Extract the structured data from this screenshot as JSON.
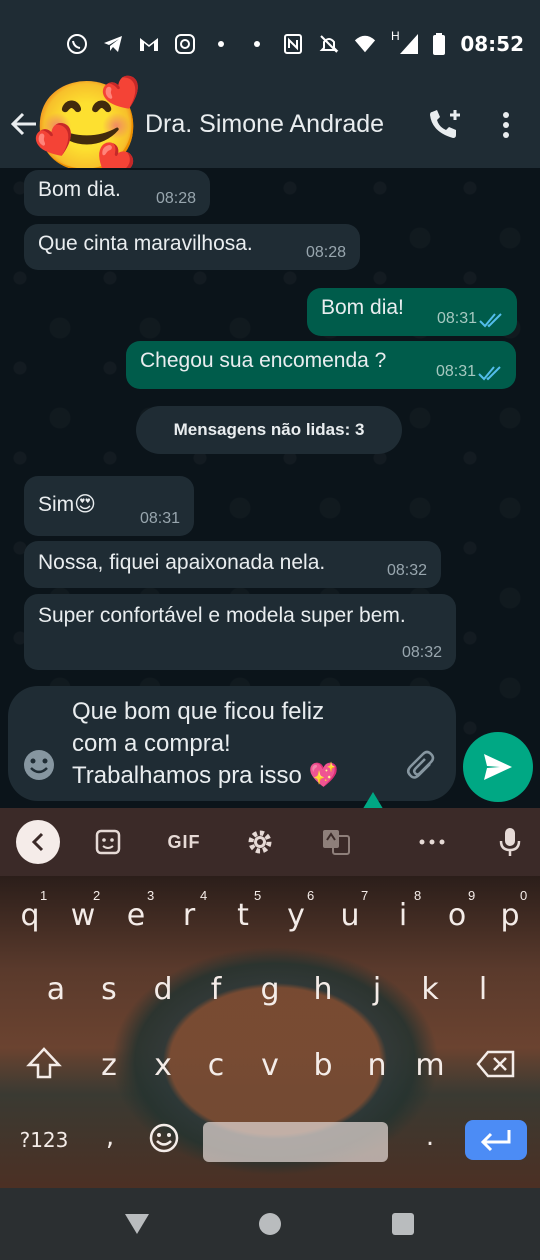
{
  "status_bar": {
    "time": "08:52",
    "icons": [
      "whatsapp-icon",
      "telegram-icon",
      "gmail-icon",
      "instagram-icon",
      "dot-icon",
      "dot-icon",
      "nfc-icon",
      "mute-icon",
      "wifi-icon",
      "signal-icon",
      "battery-icon"
    ],
    "network_label": "H"
  },
  "header": {
    "contact_name": "Dra. Simone Andrade",
    "avatar_emoji": "🥰"
  },
  "messages": [
    {
      "dir": "in",
      "text": "Bom dia.",
      "time": "08:28"
    },
    {
      "dir": "in",
      "text": "Que cinta maravilhosa.",
      "time": "08:28"
    },
    {
      "dir": "out",
      "text": "Bom dia!",
      "time": "08:31",
      "read": true
    },
    {
      "dir": "out",
      "text": "Chegou sua encomenda ?",
      "time": "08:31",
      "read": true
    },
    {
      "dir": "in",
      "text": "Sim😍",
      "time": "08:31"
    },
    {
      "dir": "in",
      "text": "Nossa, fiquei apaixonada nela.",
      "time": "08:32"
    },
    {
      "dir": "in",
      "text": "Super confortável e modela super bem.",
      "time": "08:32"
    }
  ],
  "unread_banner": "Mensagens não lidas: 3",
  "composer": {
    "text": "Que bom que ficou feliz com a compra! Trabalhamos pra isso 💖"
  },
  "keyboard": {
    "toolbar": {
      "gif_label": "GIF"
    },
    "row1": [
      "q",
      "w",
      "e",
      "r",
      "t",
      "y",
      "u",
      "i",
      "o",
      "p"
    ],
    "row1_hints": [
      "1",
      "2",
      "3",
      "4",
      "5",
      "6",
      "7",
      "8",
      "9",
      "0"
    ],
    "row2": [
      "a",
      "s",
      "d",
      "f",
      "g",
      "h",
      "j",
      "k",
      "l"
    ],
    "row3": [
      "z",
      "x",
      "c",
      "v",
      "b",
      "n",
      "m"
    ],
    "symbols_label": "?123",
    "comma_label": ",",
    "period_label": "."
  }
}
